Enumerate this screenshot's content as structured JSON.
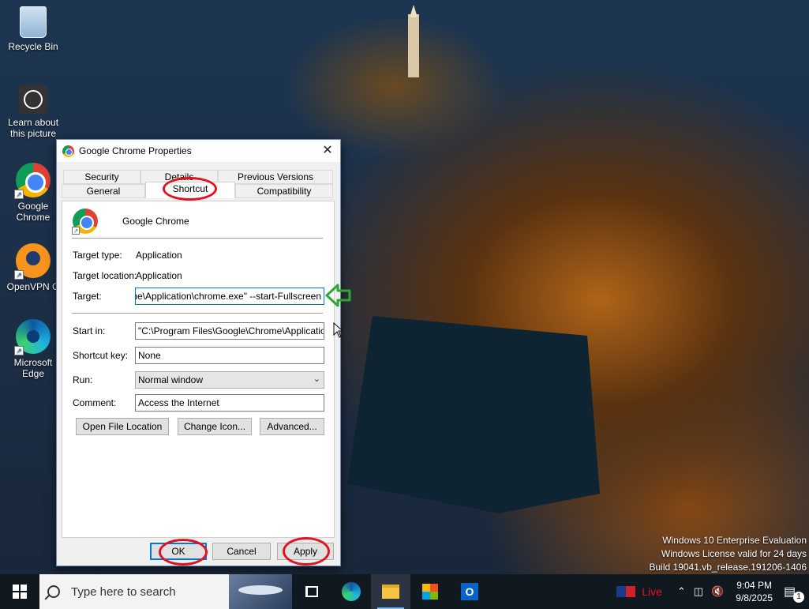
{
  "desktop": {
    "icons": [
      {
        "label": "Recycle Bin"
      },
      {
        "label": "Learn about this picture"
      },
      {
        "label": "Google Chrome"
      },
      {
        "label": "OpenVPN G"
      },
      {
        "label": "Microsoft Edge"
      }
    ],
    "watermark": {
      "line1": "Windows 10 Enterprise Evaluation",
      "line2": "Windows License valid for 24 days",
      "line3": "Build 19041.vb_release.191206-1406"
    }
  },
  "dialog": {
    "title": "Google Chrome Properties",
    "close_glyph": "✕",
    "tabs": [
      {
        "label": "Security"
      },
      {
        "label": "Details"
      },
      {
        "label": "Previous Versions"
      },
      {
        "label": "General"
      },
      {
        "label": "Shortcut",
        "active": true
      },
      {
        "label": "Compatibility"
      }
    ],
    "app_name": "Google Chrome",
    "target_type_label": "Target type:",
    "target_type_value": "Application",
    "target_location_label": "Target location:",
    "target_location_value": "Application",
    "target_label": "Target:",
    "target_value": "Chrome\\Application\\chrome.exe\" --start-Fullscreen",
    "start_in_label": "Start in:",
    "start_in_value": "\"C:\\Program Files\\Google\\Chrome\\Application\"",
    "shortcut_key_label": "Shortcut key:",
    "shortcut_key_value": "None",
    "run_label": "Run:",
    "run_value": "Normal window",
    "comment_label": "Comment:",
    "comment_value": "Access the Internet",
    "buttons": {
      "open_file_location": "Open File Location",
      "change_icon": "Change Icon...",
      "advanced": "Advanced...",
      "ok": "OK",
      "cancel": "Cancel",
      "apply": "Apply"
    },
    "annotation_color": "#e0141e",
    "arrow_color": "#2aa830"
  },
  "taskbar": {
    "search_placeholder": "Type here to search",
    "live_label": "Live",
    "time": "9:04 PM",
    "date": "9/8/2025",
    "notification_count": "1",
    "icons": [
      "start-icon",
      "task-view-icon",
      "edge-icon",
      "file-explorer-icon",
      "store-icon",
      "outlook-icon"
    ]
  }
}
